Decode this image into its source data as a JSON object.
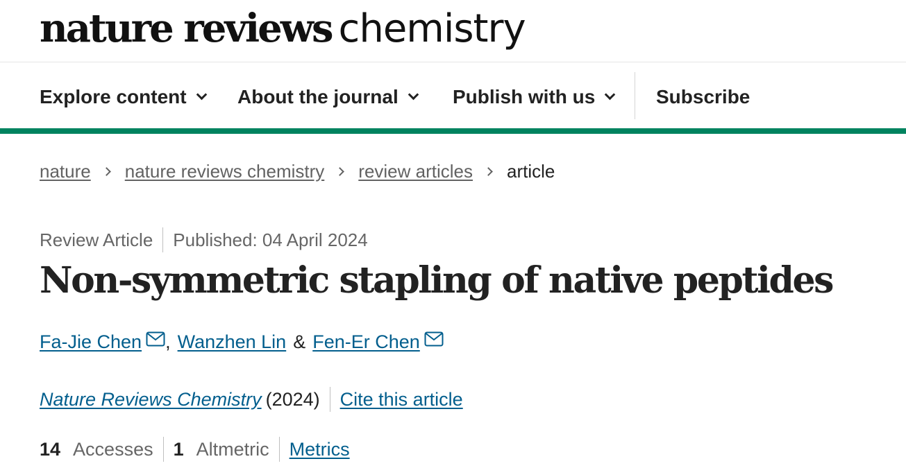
{
  "masthead": {
    "logo_bold": "nature reviews",
    "logo_light": "chemistry"
  },
  "nav": {
    "items": [
      {
        "label": "Explore content"
      },
      {
        "label": "About the journal"
      },
      {
        "label": "Publish with us"
      }
    ],
    "subscribe": "Subscribe"
  },
  "breadcrumb": {
    "items": [
      "nature",
      "nature reviews chemistry",
      "review articles"
    ],
    "current": "article"
  },
  "article": {
    "type": "Review Article",
    "published": "Published: 04 April 2024",
    "title": "Non-symmetric stapling of native peptides",
    "authors": [
      "Fa-Jie Chen",
      "Wanzhen Lin",
      "Fen-Er Chen"
    ],
    "author_sep_comma": ",",
    "author_sep_amp": "&",
    "journal": "Nature Reviews Chemistry",
    "year": "(2024)",
    "cite": "Cite this article",
    "accesses_count": "14",
    "accesses_label": "Accesses",
    "altmetric_count": "1",
    "altmetric_label": "Altmetric",
    "metrics_link": "Metrics"
  },
  "colors": {
    "brand_green": "#00835f",
    "link_blue": "#025e8d"
  }
}
